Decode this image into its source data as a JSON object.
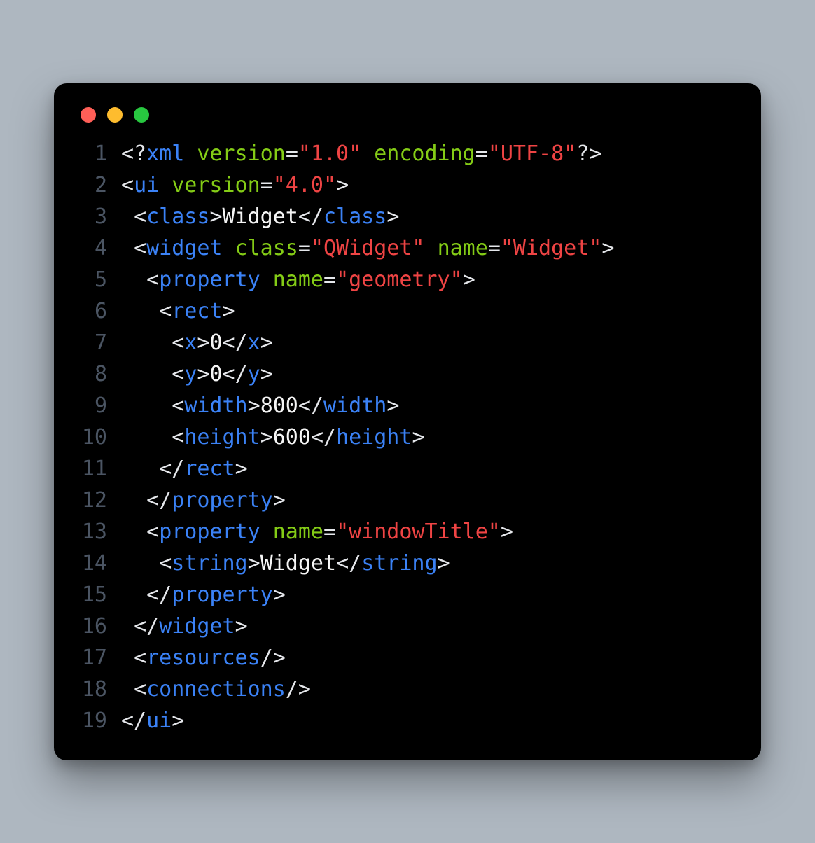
{
  "window": {
    "traffic_lights": [
      "red",
      "yellow",
      "green"
    ]
  },
  "code": {
    "lines": [
      {
        "n": "1",
        "tokens": [
          {
            "c": "t-punct",
            "v": "<?"
          },
          {
            "c": "t-tag",
            "v": "xml"
          },
          {
            "c": "",
            "v": " "
          },
          {
            "c": "t-attr",
            "v": "version"
          },
          {
            "c": "t-punct",
            "v": "="
          },
          {
            "c": "t-string",
            "v": "\"1.0\""
          },
          {
            "c": "",
            "v": " "
          },
          {
            "c": "t-attr",
            "v": "encoding"
          },
          {
            "c": "t-punct",
            "v": "="
          },
          {
            "c": "t-string",
            "v": "\"UTF-8\""
          },
          {
            "c": "t-punct",
            "v": "?>"
          }
        ]
      },
      {
        "n": "2",
        "tokens": [
          {
            "c": "t-punct",
            "v": "<"
          },
          {
            "c": "t-tag",
            "v": "ui"
          },
          {
            "c": "",
            "v": " "
          },
          {
            "c": "t-attr",
            "v": "version"
          },
          {
            "c": "t-punct",
            "v": "="
          },
          {
            "c": "t-string",
            "v": "\"4.0\""
          },
          {
            "c": "t-punct",
            "v": ">"
          }
        ]
      },
      {
        "n": "3",
        "tokens": [
          {
            "c": "",
            "v": " "
          },
          {
            "c": "t-punct",
            "v": "<"
          },
          {
            "c": "t-tag",
            "v": "class"
          },
          {
            "c": "t-punct",
            "v": ">"
          },
          {
            "c": "t-text",
            "v": "Widget"
          },
          {
            "c": "t-punct",
            "v": "</"
          },
          {
            "c": "t-tag",
            "v": "class"
          },
          {
            "c": "t-punct",
            "v": ">"
          }
        ]
      },
      {
        "n": "4",
        "tokens": [
          {
            "c": "",
            "v": " "
          },
          {
            "c": "t-punct",
            "v": "<"
          },
          {
            "c": "t-tag",
            "v": "widget"
          },
          {
            "c": "",
            "v": " "
          },
          {
            "c": "t-attr",
            "v": "class"
          },
          {
            "c": "t-punct",
            "v": "="
          },
          {
            "c": "t-string",
            "v": "\"QWidget\""
          },
          {
            "c": "",
            "v": " "
          },
          {
            "c": "t-attr",
            "v": "name"
          },
          {
            "c": "t-punct",
            "v": "="
          },
          {
            "c": "t-string",
            "v": "\"Widget\""
          },
          {
            "c": "t-punct",
            "v": ">"
          }
        ]
      },
      {
        "n": "5",
        "tokens": [
          {
            "c": "",
            "v": "  "
          },
          {
            "c": "t-punct",
            "v": "<"
          },
          {
            "c": "t-tag",
            "v": "property"
          },
          {
            "c": "",
            "v": " "
          },
          {
            "c": "t-attr",
            "v": "name"
          },
          {
            "c": "t-punct",
            "v": "="
          },
          {
            "c": "t-string",
            "v": "\"geometry\""
          },
          {
            "c": "t-punct",
            "v": ">"
          }
        ]
      },
      {
        "n": "6",
        "tokens": [
          {
            "c": "",
            "v": "   "
          },
          {
            "c": "t-punct",
            "v": "<"
          },
          {
            "c": "t-tag",
            "v": "rect"
          },
          {
            "c": "t-punct",
            "v": ">"
          }
        ]
      },
      {
        "n": "7",
        "tokens": [
          {
            "c": "",
            "v": "    "
          },
          {
            "c": "t-punct",
            "v": "<"
          },
          {
            "c": "t-tag",
            "v": "x"
          },
          {
            "c": "t-punct",
            "v": ">"
          },
          {
            "c": "t-text",
            "v": "0"
          },
          {
            "c": "t-punct",
            "v": "</"
          },
          {
            "c": "t-tag",
            "v": "x"
          },
          {
            "c": "t-punct",
            "v": ">"
          }
        ]
      },
      {
        "n": "8",
        "tokens": [
          {
            "c": "",
            "v": "    "
          },
          {
            "c": "t-punct",
            "v": "<"
          },
          {
            "c": "t-tag",
            "v": "y"
          },
          {
            "c": "t-punct",
            "v": ">"
          },
          {
            "c": "t-text",
            "v": "0"
          },
          {
            "c": "t-punct",
            "v": "</"
          },
          {
            "c": "t-tag",
            "v": "y"
          },
          {
            "c": "t-punct",
            "v": ">"
          }
        ]
      },
      {
        "n": "9",
        "tokens": [
          {
            "c": "",
            "v": "    "
          },
          {
            "c": "t-punct",
            "v": "<"
          },
          {
            "c": "t-tag",
            "v": "width"
          },
          {
            "c": "t-punct",
            "v": ">"
          },
          {
            "c": "t-text",
            "v": "800"
          },
          {
            "c": "t-punct",
            "v": "</"
          },
          {
            "c": "t-tag",
            "v": "width"
          },
          {
            "c": "t-punct",
            "v": ">"
          }
        ]
      },
      {
        "n": "10",
        "tokens": [
          {
            "c": "",
            "v": "    "
          },
          {
            "c": "t-punct",
            "v": "<"
          },
          {
            "c": "t-tag",
            "v": "height"
          },
          {
            "c": "t-punct",
            "v": ">"
          },
          {
            "c": "t-text",
            "v": "600"
          },
          {
            "c": "t-punct",
            "v": "</"
          },
          {
            "c": "t-tag",
            "v": "height"
          },
          {
            "c": "t-punct",
            "v": ">"
          }
        ]
      },
      {
        "n": "11",
        "tokens": [
          {
            "c": "",
            "v": "   "
          },
          {
            "c": "t-punct",
            "v": "</"
          },
          {
            "c": "t-tag",
            "v": "rect"
          },
          {
            "c": "t-punct",
            "v": ">"
          }
        ]
      },
      {
        "n": "12",
        "tokens": [
          {
            "c": "",
            "v": "  "
          },
          {
            "c": "t-punct",
            "v": "</"
          },
          {
            "c": "t-tag",
            "v": "property"
          },
          {
            "c": "t-punct",
            "v": ">"
          }
        ]
      },
      {
        "n": "13",
        "tokens": [
          {
            "c": "",
            "v": "  "
          },
          {
            "c": "t-punct",
            "v": "<"
          },
          {
            "c": "t-tag",
            "v": "property"
          },
          {
            "c": "",
            "v": " "
          },
          {
            "c": "t-attr",
            "v": "name"
          },
          {
            "c": "t-punct",
            "v": "="
          },
          {
            "c": "t-string",
            "v": "\"windowTitle\""
          },
          {
            "c": "t-punct",
            "v": ">"
          }
        ]
      },
      {
        "n": "14",
        "tokens": [
          {
            "c": "",
            "v": "   "
          },
          {
            "c": "t-punct",
            "v": "<"
          },
          {
            "c": "t-tag",
            "v": "string"
          },
          {
            "c": "t-punct",
            "v": ">"
          },
          {
            "c": "t-text",
            "v": "Widget"
          },
          {
            "c": "t-punct",
            "v": "</"
          },
          {
            "c": "t-tag",
            "v": "string"
          },
          {
            "c": "t-punct",
            "v": ">"
          }
        ]
      },
      {
        "n": "15",
        "tokens": [
          {
            "c": "",
            "v": "  "
          },
          {
            "c": "t-punct",
            "v": "</"
          },
          {
            "c": "t-tag",
            "v": "property"
          },
          {
            "c": "t-punct",
            "v": ">"
          }
        ]
      },
      {
        "n": "16",
        "tokens": [
          {
            "c": "",
            "v": " "
          },
          {
            "c": "t-punct",
            "v": "</"
          },
          {
            "c": "t-tag",
            "v": "widget"
          },
          {
            "c": "t-punct",
            "v": ">"
          }
        ]
      },
      {
        "n": "17",
        "tokens": [
          {
            "c": "",
            "v": " "
          },
          {
            "c": "t-punct",
            "v": "<"
          },
          {
            "c": "t-tag",
            "v": "resources"
          },
          {
            "c": "t-punct",
            "v": "/>"
          }
        ]
      },
      {
        "n": "18",
        "tokens": [
          {
            "c": "",
            "v": " "
          },
          {
            "c": "t-punct",
            "v": "<"
          },
          {
            "c": "t-tag",
            "v": "connections"
          },
          {
            "c": "t-punct",
            "v": "/>"
          }
        ]
      },
      {
        "n": "19",
        "tokens": [
          {
            "c": "t-punct",
            "v": "</"
          },
          {
            "c": "t-tag",
            "v": "ui"
          },
          {
            "c": "t-punct",
            "v": ">"
          }
        ]
      }
    ]
  }
}
